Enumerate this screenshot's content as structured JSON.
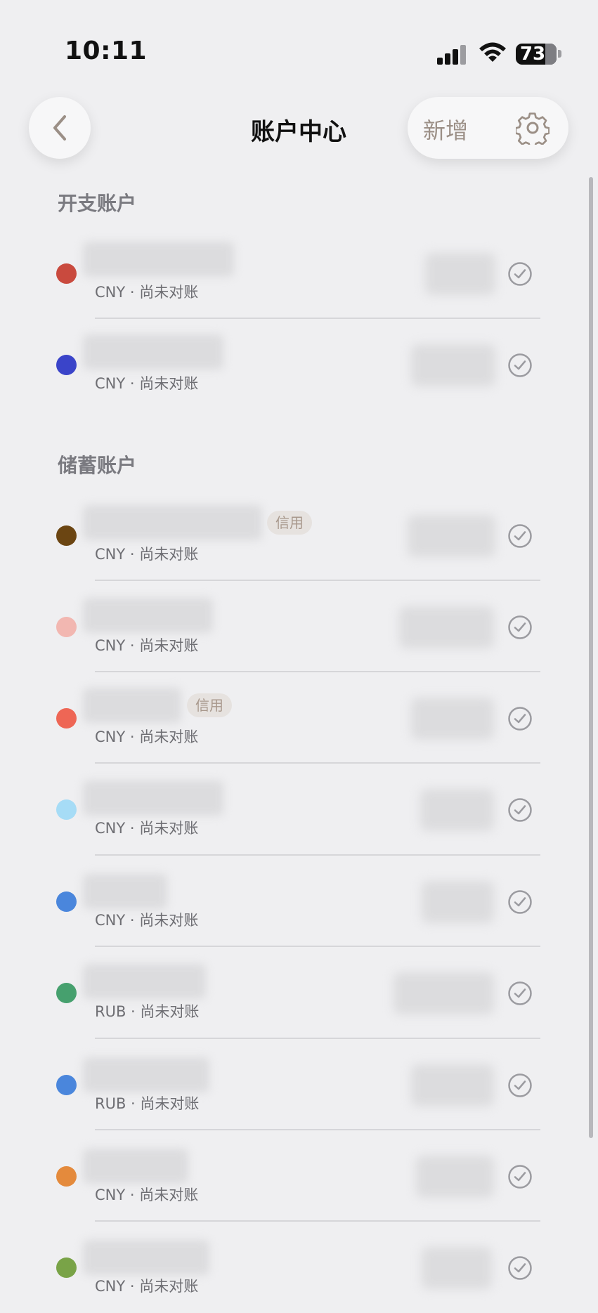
{
  "status": {
    "time": "10:11",
    "battery": "73"
  },
  "nav": {
    "title": "账户中心",
    "add_label": "新增"
  },
  "sections": [
    {
      "title": "开支账户"
    },
    {
      "title": "储蓄账户"
    }
  ],
  "accounts": [
    {
      "currency_status": "CNY · 尚未对账",
      "color": "#c94a3e"
    },
    {
      "currency_status": "CNY · 尚未对账",
      "color": "#3a44c9"
    },
    {
      "currency_status": "CNY · 尚未对账",
      "color": "#6b4512",
      "tag": "信用"
    },
    {
      "currency_status": "CNY · 尚未对账",
      "color": "#f2b7b1"
    },
    {
      "currency_status": "CNY · 尚未对账",
      "color": "#ee6655",
      "tag": "信用"
    },
    {
      "currency_status": "CNY · 尚未对账",
      "color": "#a6dcf6"
    },
    {
      "currency_status": "CNY · 尚未对账",
      "color": "#4a86dc"
    },
    {
      "currency_status": "RUB · 尚未对账",
      "color": "#46a06e"
    },
    {
      "currency_status": "RUB · 尚未对账",
      "color": "#4a86dc"
    },
    {
      "currency_status": "CNY · 尚未对账",
      "color": "#e48a3c"
    },
    {
      "currency_status": "CNY · 尚未对账",
      "color": "#79a347"
    }
  ],
  "icons": {
    "back": "chevron-left-icon",
    "settings": "gear-icon",
    "check": "check-circle-icon",
    "signal": "cellular-signal-icon",
    "wifi": "wifi-icon",
    "battery": "battery-icon"
  }
}
